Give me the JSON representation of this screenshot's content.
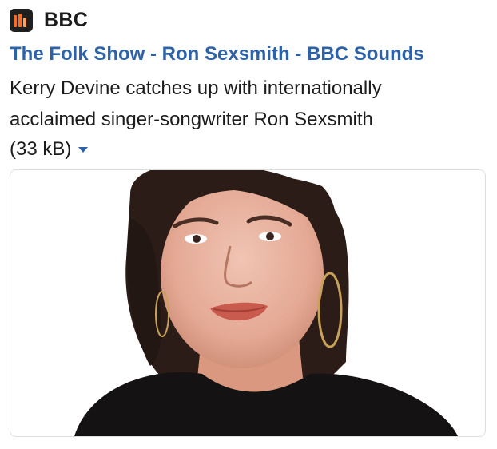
{
  "service": {
    "name": "BBC",
    "icon": "bbc-sounds-icon"
  },
  "link": {
    "title": "The Folk Show - Ron Sexsmith - BBC Sounds",
    "color": "#2e62a8"
  },
  "description": "Kerry Devine catches up with internationally acclaimed singer-songwriter Ron Sexsmith",
  "attachment": {
    "size": "(33 kB)",
    "toggle_icon": "caret-down-icon"
  },
  "preview_image": {
    "subject": "portrait-photo"
  },
  "colors": {
    "accent": "#2e62a8",
    "icon_bg": "#1f1f1f",
    "icon_orange": "#f36f21"
  }
}
